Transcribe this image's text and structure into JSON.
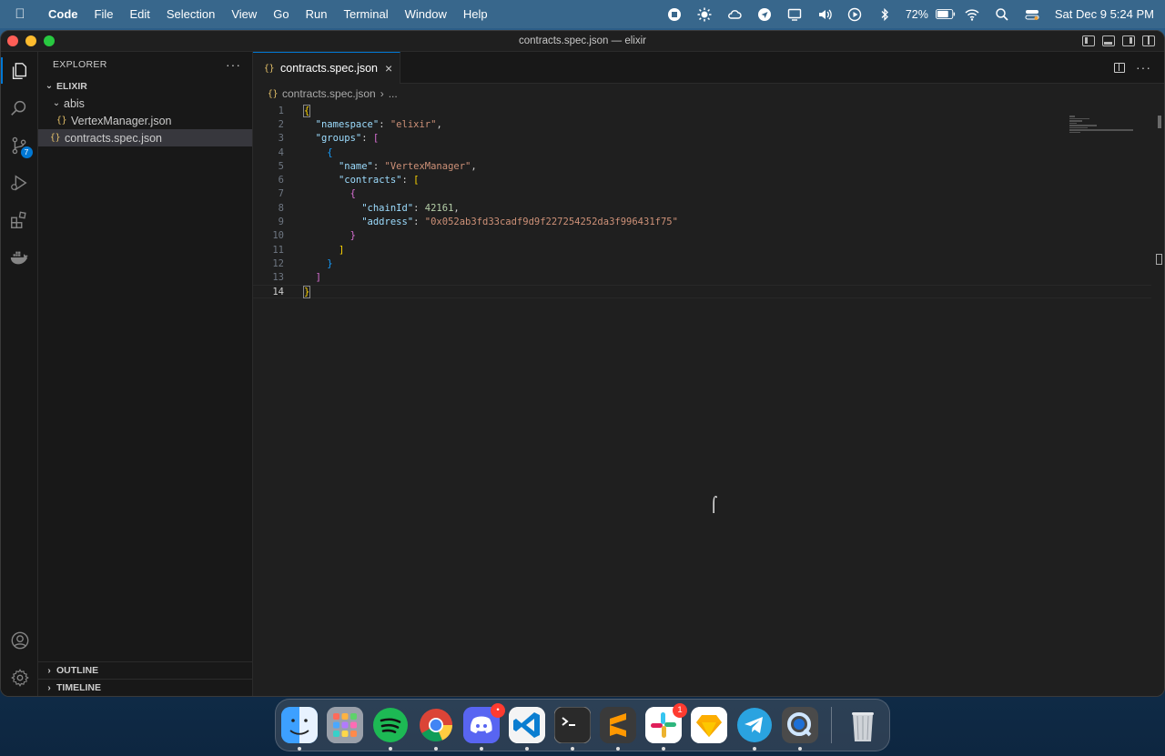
{
  "menubar": {
    "app": "Code",
    "items": [
      "File",
      "Edit",
      "Selection",
      "View",
      "Go",
      "Run",
      "Terminal",
      "Window",
      "Help"
    ],
    "battery": "72%",
    "clock": "Sat Dec 9  5:24 PM",
    "tray_icons": [
      "record-icon",
      "brightness-icon",
      "cloud-icon",
      "location-icon",
      "display-icon",
      "volume-icon",
      "play-icon",
      "bluetooth-icon"
    ]
  },
  "window": {
    "title": "contracts.spec.json — elixir"
  },
  "activitybar": {
    "scm_badge": "7"
  },
  "sidebar": {
    "header": "EXPLORER",
    "more": "···",
    "root": "ELIXIR",
    "folder": "abis",
    "files": [
      "VertexManager.json",
      "contracts.spec.json"
    ],
    "outline": "OUTLINE",
    "timeline": "TIMELINE"
  },
  "editor": {
    "tab_label": "contracts.spec.json",
    "breadcrumb_file": "contracts.spec.json",
    "breadcrumb_more": "...",
    "json_icon": "{}",
    "lines": [
      "1",
      "2",
      "3",
      "4",
      "5",
      "6",
      "7",
      "8",
      "9",
      "10",
      "11",
      "12",
      "13",
      "14"
    ],
    "code": {
      "k_namespace": "\"namespace\"",
      "v_namespace": "\"elixir\"",
      "k_groups": "\"groups\"",
      "k_name": "\"name\"",
      "v_name": "\"VertexManager\"",
      "k_contracts": "\"contracts\"",
      "k_chainId": "\"chainId\"",
      "v_chainId": "42161",
      "k_address": "\"address\"",
      "v_address": "\"0x052ab3fd33cadf9d9f227254252da3f996431f75\""
    }
  },
  "dock": {
    "apps": [
      "Finder",
      "Launchpad",
      "Spotify",
      "Chrome",
      "Discord",
      "Visual Studio Code",
      "Terminal",
      "Sublime Text",
      "Slack",
      "Sketch",
      "Telegram",
      "QuickTime",
      "Trash"
    ],
    "discord_badge": "•",
    "slack_badge": "1",
    "colors": {
      "finder": "#2f8cf1",
      "spotify": "#1db954",
      "discord": "#5865f2",
      "vscode": "#0b7ed1",
      "sublime": "#ff9800",
      "telegram": "#2aa3e0"
    }
  }
}
